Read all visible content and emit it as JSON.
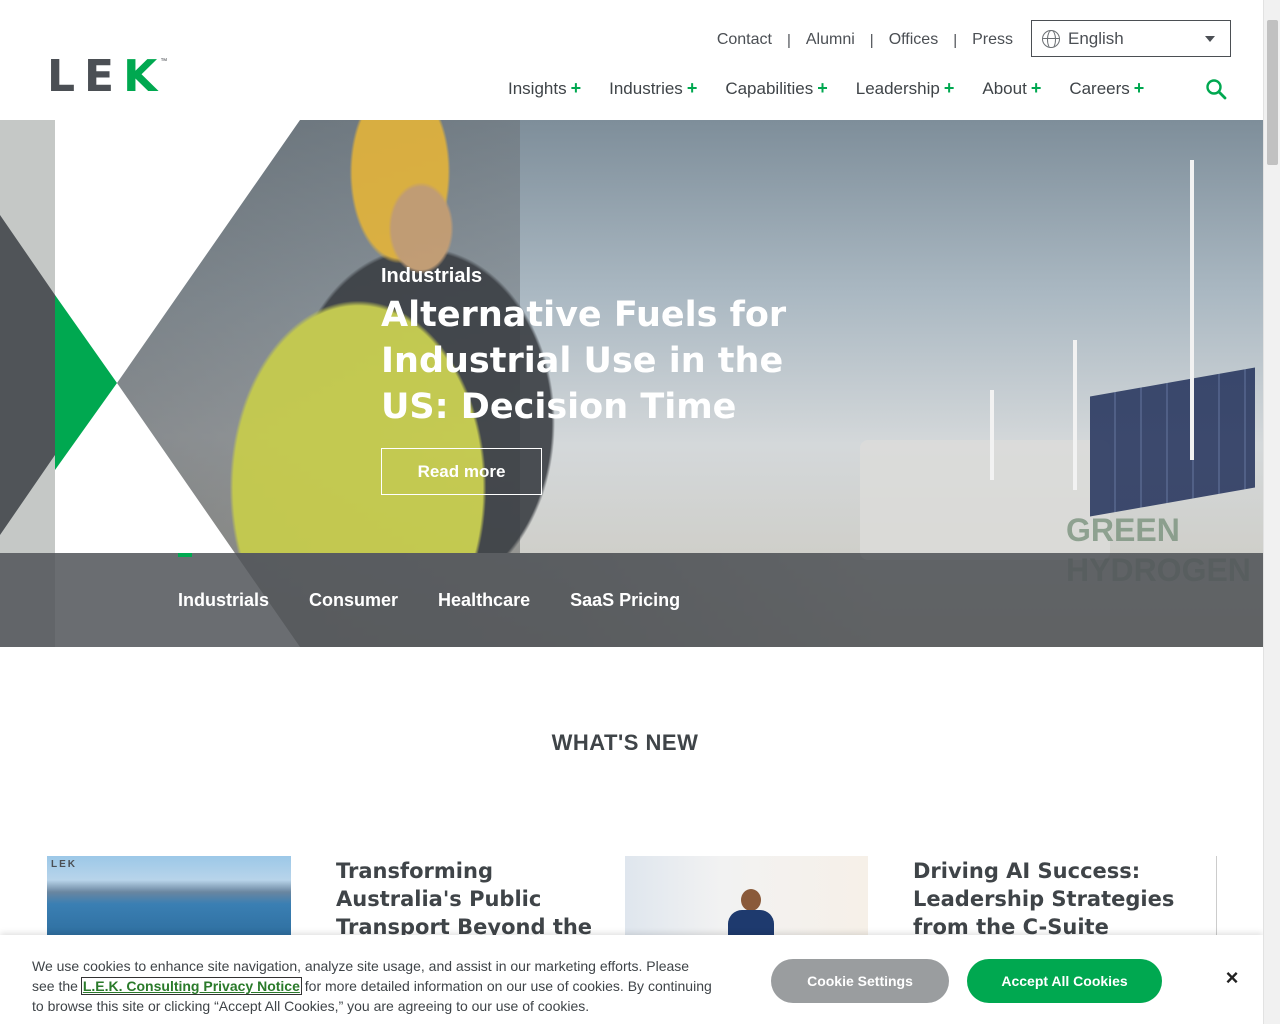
{
  "header": {
    "logo_text_a": "LE",
    "logo_text_b": "K",
    "logo_tm": "™",
    "utility_links": [
      "Contact",
      "Alumni",
      "Offices",
      "Press"
    ],
    "language": "English",
    "nav": [
      "Insights",
      "Industries",
      "Capabilities",
      "Leadership",
      "About",
      "Careers"
    ],
    "nav_expand_symbol": "+"
  },
  "hero": {
    "kicker": "Industrials",
    "title": "Alternative Fuels for Industrial Use in the US: Decision Time",
    "button": "Read more",
    "background_text": "GREEN HYDROGEN",
    "tabs": [
      "Industrials",
      "Consumer",
      "Healthcare",
      "SaaS Pricing"
    ]
  },
  "whats_new": {
    "heading": "WHAT'S NEW",
    "cards": [
      {
        "image_label": "LEK",
        "title": "Transforming Australia's Public Transport Beyond the Pandemic"
      },
      {
        "title": "Driving AI Success: Leadership Strategies from the C-Suite"
      }
    ]
  },
  "cookie_banner": {
    "text_before": "We use cookies to enhance site navigation, analyze site usage, and assist in our marketing efforts. Please see the ",
    "link": "L.E.K. Consulting Privacy Notice",
    "text_after": " for more detailed information on our use of cookies. By continuing to browse this site or clicking “Accept All Cookies,” you are agreeing to our use of cookies.",
    "settings_button": "Cookie Settings",
    "accept_button": "Accept All Cookies",
    "close_symbol": "×"
  },
  "colors": {
    "brand_green": "#00a850",
    "text_dark": "#3f4448",
    "settings_gray": "#9a9d9f"
  }
}
